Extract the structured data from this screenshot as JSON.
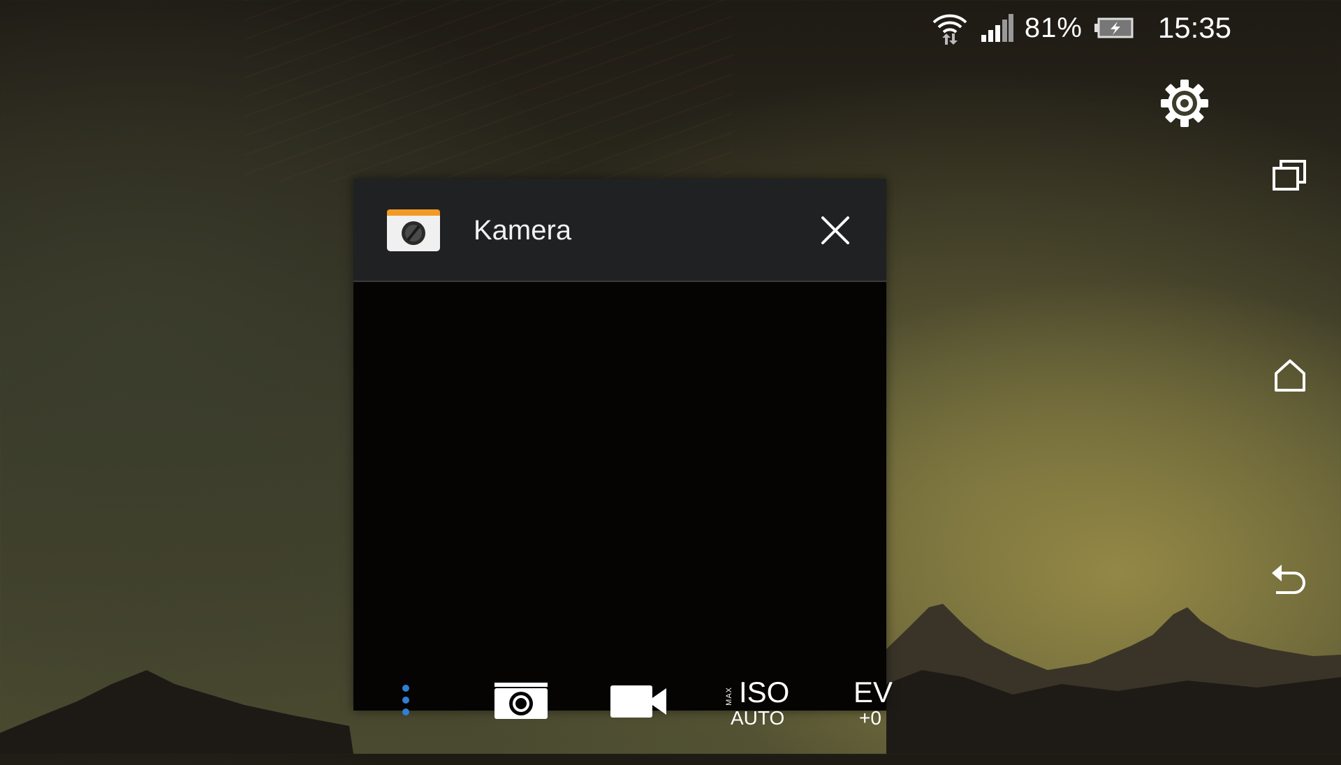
{
  "status_bar": {
    "battery_percent": "81%",
    "time": "15:35",
    "icons": [
      "wifi-icon",
      "signal-icon",
      "battery-charging-icon"
    ]
  },
  "settings": {
    "icon": "gear-icon"
  },
  "nav": {
    "items": [
      "recents-icon",
      "home-icon",
      "back-icon"
    ]
  },
  "window": {
    "title": "Kamera",
    "app_icon": "camera-app-icon",
    "close_icon": "close-icon"
  },
  "toolbar": {
    "more_icon": "more-vert-icon",
    "photo_icon": "camera-icon",
    "video_icon": "video-camera-icon",
    "iso": {
      "prefix": "MAX",
      "label": "ISO",
      "value": "AUTO"
    },
    "ev": {
      "label": "EV",
      "value": "+0"
    }
  },
  "colors": {
    "window_header": "#202123",
    "viewfinder": "#050403",
    "accent_blue": "#2f7fd4",
    "app_icon_top": "#f39a26"
  }
}
